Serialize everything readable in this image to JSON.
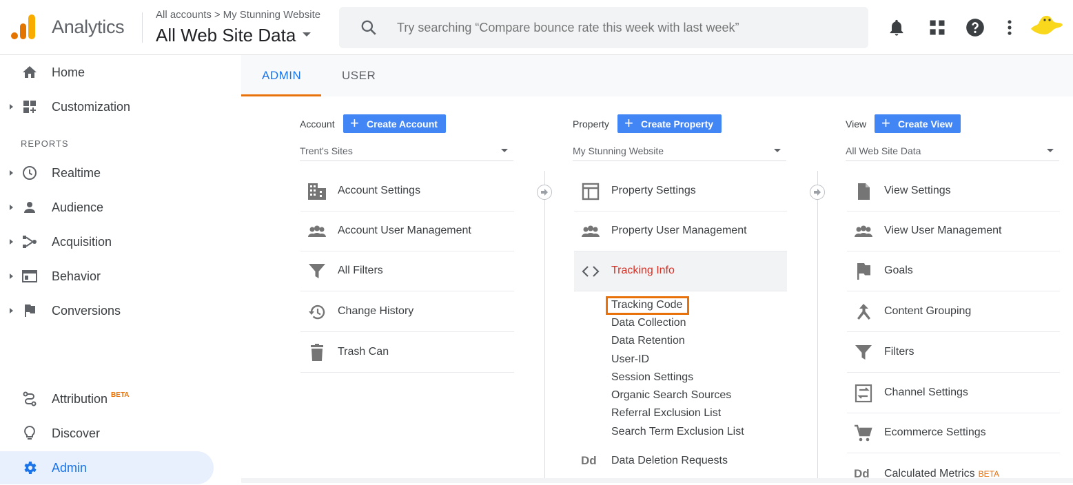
{
  "header": {
    "app_name": "Analytics",
    "breadcrumb_root": "All accounts",
    "breadcrumb_property": "My Stunning Website",
    "view_selector": "All Web Site Data",
    "search_placeholder": "Try searching “Compare bounce rate this week with last week”"
  },
  "colors": {
    "accent": "#1a73e8",
    "orange": "#e8710a",
    "button_blue": "#4285f4",
    "active_red": "#d93025"
  },
  "sidebar": {
    "home": "Home",
    "customization": "Customization",
    "reports_section": "REPORTS",
    "realtime": "Realtime",
    "audience": "Audience",
    "acquisition": "Acquisition",
    "behavior": "Behavior",
    "conversions": "Conversions",
    "attribution": "Attribution",
    "attribution_badge": "BETA",
    "discover": "Discover",
    "admin": "Admin"
  },
  "tabs": {
    "admin": "ADMIN",
    "user": "USER"
  },
  "account": {
    "label": "Account",
    "create_button": "Create Account",
    "selected": "Trent's Sites",
    "items": [
      "Account Settings",
      "Account User Management",
      "All Filters",
      "Change History",
      "Trash Can"
    ]
  },
  "property": {
    "label": "Property",
    "create_button": "Create Property",
    "selected": "My Stunning Website",
    "items": [
      "Property Settings",
      "Property User Management",
      "Tracking Info",
      "Data Deletion Requests"
    ],
    "tracking_sub": [
      "Tracking Code",
      "Data Collection",
      "Data Retention",
      "User-ID",
      "Session Settings",
      "Organic Search Sources",
      "Referral Exclusion List",
      "Search Term Exclusion List"
    ]
  },
  "view": {
    "label": "View",
    "create_button": "Create View",
    "selected": "All Web Site Data",
    "items": [
      "View Settings",
      "View User Management",
      "Goals",
      "Content Grouping",
      "Filters",
      "Channel Settings",
      "Ecommerce Settings",
      "Calculated Metrics"
    ],
    "calculated_badge": "BETA"
  },
  "icon_text": {
    "dd": "Dd"
  }
}
